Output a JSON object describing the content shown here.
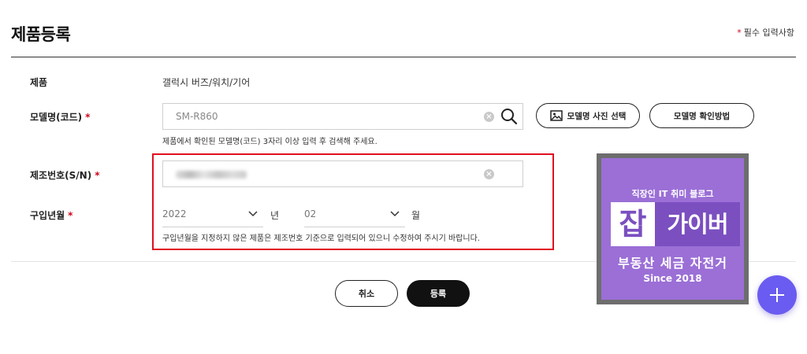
{
  "header": {
    "title": "제품등록",
    "required_star": "*",
    "required_note": "필수 입력사항"
  },
  "form": {
    "product": {
      "label": "제품",
      "value": "갤럭시 버즈/워치/기어"
    },
    "model": {
      "label": "모델명(코드)",
      "star": "*",
      "value": "SM-R860",
      "help": "제품에서 확인된 모델명(코드) 3자리 이상 입력 후 검색해 주세요.",
      "photo_button": "모델명 사진 선택",
      "check_button": "모델명 확인방법"
    },
    "serial": {
      "label": "제조번호(S/N)",
      "star": "*"
    },
    "purchase": {
      "label": "구입년월",
      "star": "*",
      "year": "2022",
      "year_unit": "년",
      "month": "02",
      "month_unit": "월",
      "help": "구입년월을 지정하지 않은 제품은 제조번호 기준으로 입력되어 있으니 수정하여 주시기 바랍니다."
    }
  },
  "actions": {
    "cancel": "취소",
    "submit": "등록"
  },
  "promo": {
    "line1": "직장인 IT 취미 블로그",
    "big_char": "잡",
    "big_word": "가이버",
    "line3": "부동산 세금 자전거",
    "line4": "Since 2018"
  },
  "colors": {
    "required": "#d0021b",
    "highlight": "#e0101e",
    "fab": "#6a5cf0",
    "promo": "#9b6fd6"
  }
}
